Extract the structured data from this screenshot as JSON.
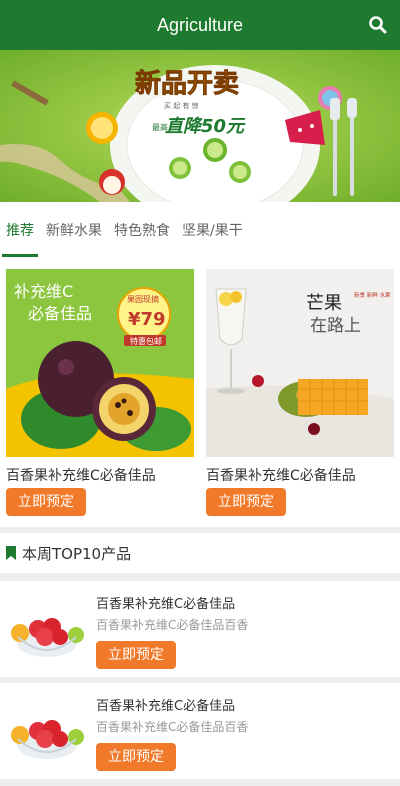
{
  "header": {
    "title": "Agriculture"
  },
  "banner": {
    "headline": "新品开卖",
    "sub_small": "买 起 有 惊",
    "sub_big": "直降50元",
    "side": "最高"
  },
  "tabs": [
    {
      "label": "推荐"
    },
    {
      "label": "新鲜水果"
    },
    {
      "label": "特色熟食"
    },
    {
      "label": "坚果/果干"
    }
  ],
  "products": [
    {
      "name": "百香果补充维C必备佳品",
      "button": "立即预定",
      "img_text1": "补充维C",
      "img_text2": "必备佳品",
      "badge_top": "果园现摘",
      "badge_price": "¥79",
      "badge_bottom": "特惠包邮"
    },
    {
      "name": "百香果补充维C必备佳品",
      "button": "立即预定",
      "img_text1": "芒果",
      "img_text2": "在路上",
      "img_small": "新季 新鲜 水果"
    }
  ],
  "section": {
    "title": "本周TOP10产品"
  },
  "items": [
    {
      "title": "百香果补充维C必备佳品",
      "desc": "百香果补充维C必备佳品百香",
      "button": "立即预定"
    },
    {
      "title": "百香果补充维C必备佳品",
      "desc": "百香果补充维C必备佳品百香",
      "button": "立即预定"
    }
  ],
  "colors": {
    "primary": "#1e7a2e",
    "accent": "#f07a2a"
  }
}
